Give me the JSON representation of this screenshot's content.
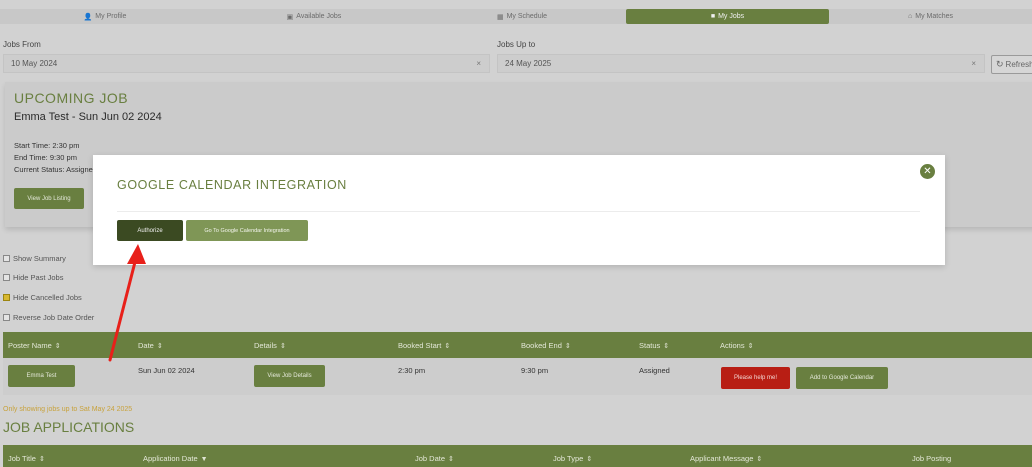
{
  "tabs": [
    {
      "label": "My Profile",
      "icon": "user-icon"
    },
    {
      "label": "Available Jobs",
      "icon": "briefcase-outline-icon"
    },
    {
      "label": "My Schedule",
      "icon": "calendar-icon"
    },
    {
      "label": "My Jobs",
      "icon": "briefcase-icon",
      "active": true
    },
    {
      "label": "My Matches",
      "icon": "home-icon"
    }
  ],
  "filters": {
    "from_label": "Jobs From",
    "from_value": "10 May 2024",
    "to_label": "Jobs Up to",
    "to_value": "24 May 2025",
    "clear_glyph": "×",
    "refresh_label": "Refresh"
  },
  "upcoming": {
    "heading": "UPCOMING JOB",
    "title": "Emma Test - Sun Jun 02 2024",
    "start": "Start Time: 2:30 pm",
    "end": "End Time: 9:30 pm",
    "status": "Current Status: Assigned",
    "view_button": "View Job Listing"
  },
  "options": [
    {
      "label": "Show Summary",
      "checked": false
    },
    {
      "label": "Hide Past Jobs",
      "checked": false
    },
    {
      "label": "Hide Cancelled Jobs",
      "checked": true
    },
    {
      "label": "Reverse Job Date Order",
      "checked": false
    }
  ],
  "jobs_table": {
    "headers": [
      "Poster Name",
      "Date",
      "Details",
      "Booked Start",
      "Booked End",
      "Status",
      "Actions"
    ],
    "rows": [
      {
        "poster": "Emma Test",
        "date": "Sun Jun 02 2024",
        "details_button": "View Job Details",
        "booked_start": "2:30 pm",
        "booked_end": "9:30 pm",
        "status": "Assigned",
        "help_button": "Please help me!",
        "calendar_button": "Add to Google Calendar"
      }
    ]
  },
  "notice": "Only showing jobs up to Sat May 24 2025",
  "applications": {
    "heading": "JOB APPLICATIONS",
    "headers": [
      "Job Title",
      "Application Date",
      "Job Date",
      "Job Type",
      "Applicant Message",
      "Job Posting"
    ]
  },
  "modal": {
    "title": "GOOGLE CALENDAR INTEGRATION",
    "authorize_button": "Authorize",
    "integration_button": "Go To Google Calendar Integration",
    "close_glyph": "✕"
  },
  "colors": {
    "accent_green": "#697f40",
    "dark_green": "#3b4a22",
    "danger_red": "#b81e14",
    "annotation_red": "#e8201a",
    "notice_gold": "#c8a23c"
  }
}
